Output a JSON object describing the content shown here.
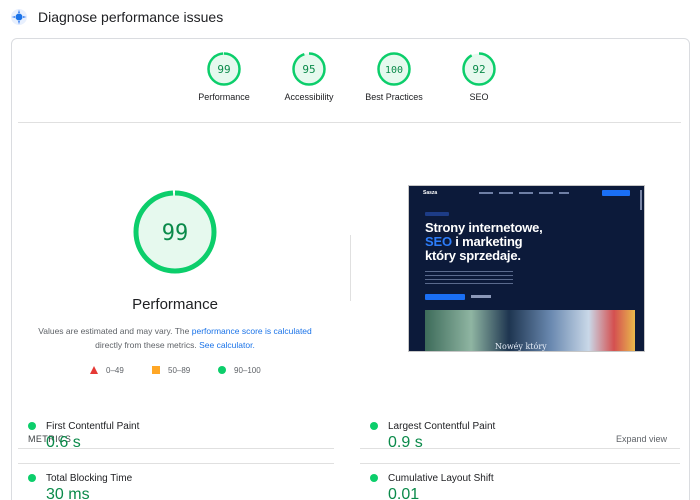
{
  "header": {
    "title": "Diagnose performance issues",
    "icon": "lighthouse-icon"
  },
  "scores": [
    {
      "label": "Performance",
      "value": "99",
      "pct": 99
    },
    {
      "label": "Accessibility",
      "value": "95",
      "pct": 95
    },
    {
      "label": "Best Practices",
      "value": "100",
      "pct": 100
    },
    {
      "label": "SEO",
      "value": "92",
      "pct": 92
    }
  ],
  "performance": {
    "score": "99",
    "pct": 99,
    "title": "Performance",
    "desc_prefix": "Values are estimated and may vary. The ",
    "desc_link1": "performance score is calculated",
    "desc_middle": " directly from these metrics. ",
    "desc_link2": "See calculator."
  },
  "legend": [
    {
      "range": "0–49",
      "color": "#e53935",
      "shape": "triangle"
    },
    {
      "range": "50–89",
      "color": "#ffa726",
      "shape": "square"
    },
    {
      "range": "90–100",
      "color": "#0cce6b",
      "shape": "circle"
    }
  ],
  "screenshot": {
    "logo": "Sasza",
    "heading_line1": "Strony internetowe,",
    "heading_line2_blue": "SEO",
    "heading_line2_rest": " i marketing",
    "heading_line3": "który sprzedaje.",
    "image_text": "Nowéy który"
  },
  "metrics": {
    "heading": "METRICS",
    "expand_label": "Expand view",
    "items": [
      {
        "name": "First Contentful Paint",
        "value": "0.6 s"
      },
      {
        "name": "Largest Contentful Paint",
        "value": "0.9 s"
      },
      {
        "name": "Total Blocking Time",
        "value": "30 ms"
      },
      {
        "name": "Cumulative Layout Shift",
        "value": "0.01"
      }
    ]
  },
  "colors": {
    "good": "#0cce6b",
    "good_text": "#0a8a4a",
    "good_bg": "#e6f9ee",
    "link": "#1a73e8"
  }
}
